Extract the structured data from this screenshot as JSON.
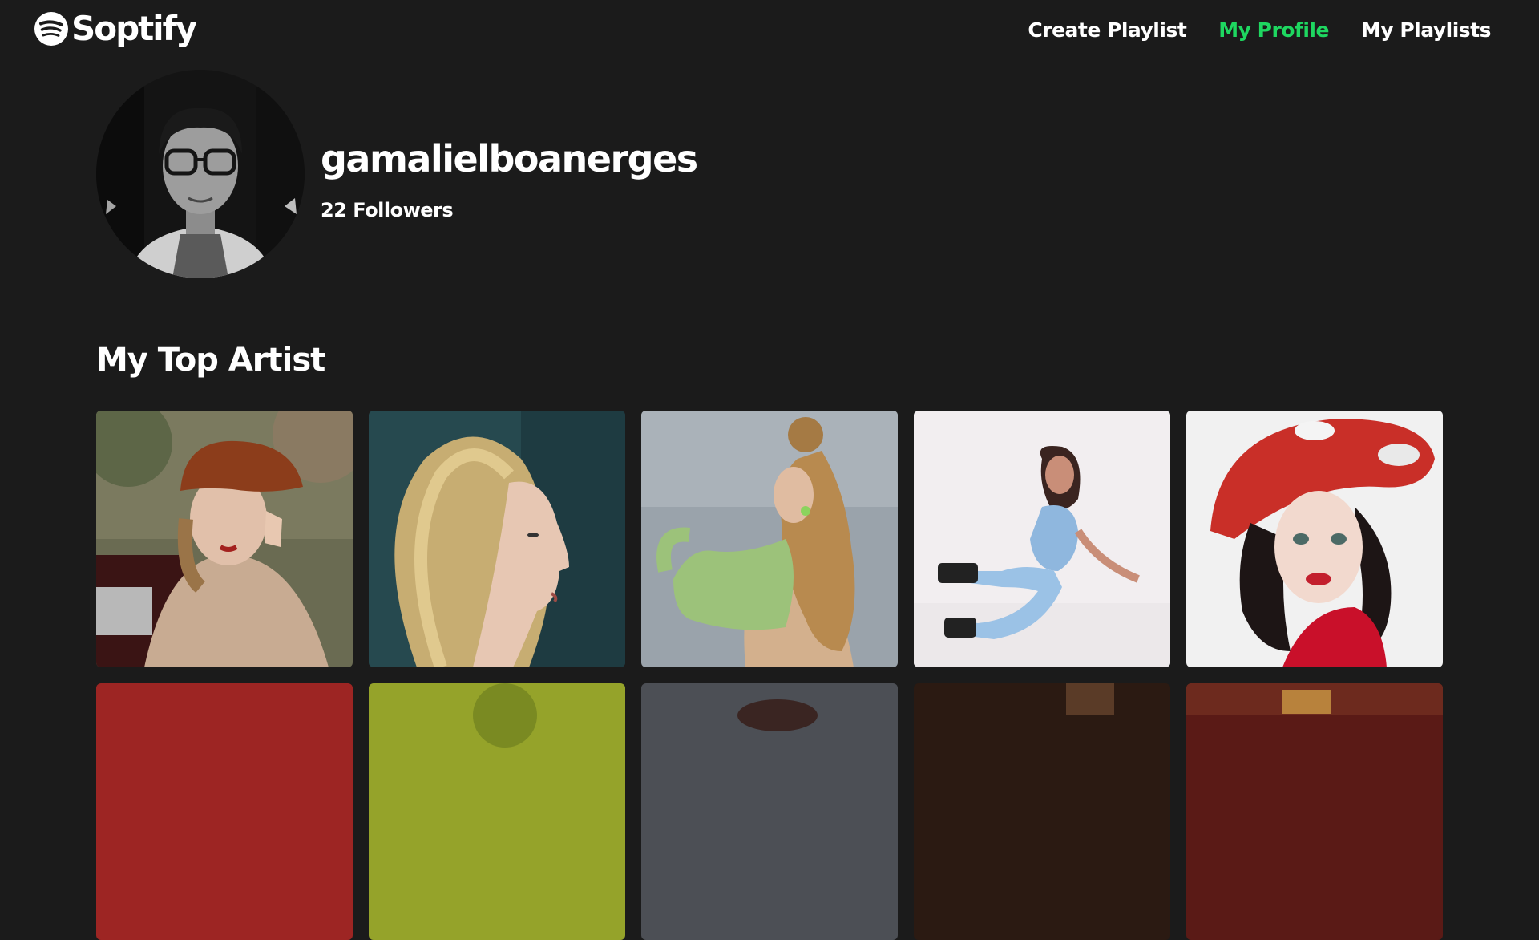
{
  "app": {
    "brand": "Soptify",
    "accent_color": "#1ed760",
    "background_color": "#1b1b1b"
  },
  "nav": {
    "items": [
      {
        "label": "Create Playlist",
        "active": false
      },
      {
        "label": "My Profile",
        "active": true
      },
      {
        "label": "My Playlists",
        "active": false
      }
    ]
  },
  "profile": {
    "username": "gamalielboanerges",
    "followers": "22 Followers"
  },
  "top_artists": {
    "title": "My Top Artist",
    "rows_visible": 2,
    "cards_per_row": 5
  }
}
